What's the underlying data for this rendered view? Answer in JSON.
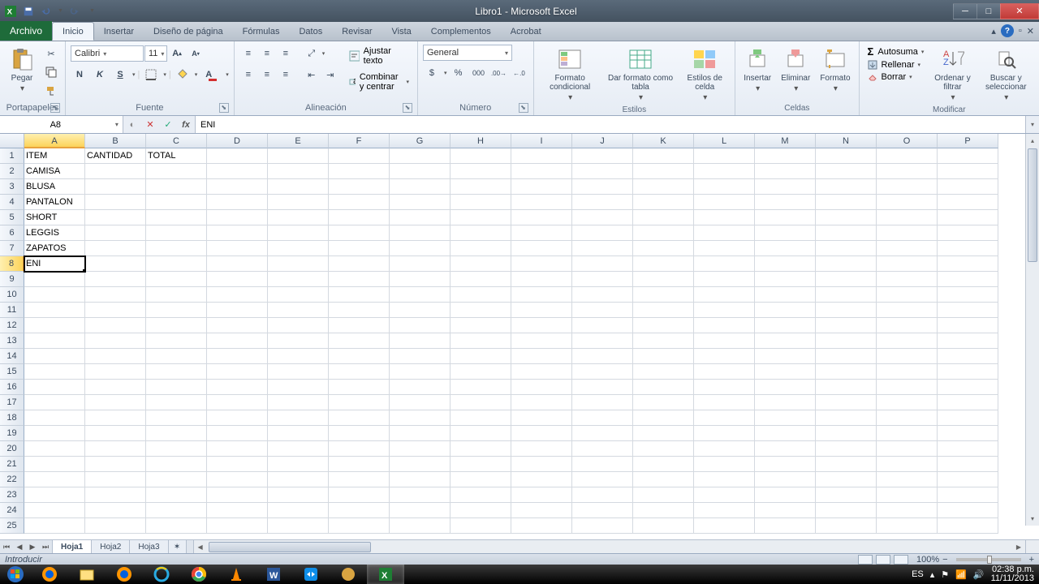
{
  "window": {
    "title": "Libro1 - Microsoft Excel"
  },
  "tabs": {
    "file": "Archivo",
    "items": [
      "Inicio",
      "Insertar",
      "Diseño de página",
      "Fórmulas",
      "Datos",
      "Revisar",
      "Vista",
      "Complementos",
      "Acrobat"
    ],
    "active": 0
  },
  "ribbon": {
    "clipboard": {
      "label": "Portapapeles",
      "paste": "Pegar"
    },
    "font": {
      "label": "Fuente",
      "name": "Calibri",
      "size": "11"
    },
    "alignment": {
      "label": "Alineación",
      "wrap": "Ajustar texto",
      "merge": "Combinar y centrar"
    },
    "number": {
      "label": "Número",
      "format": "General"
    },
    "styles": {
      "label": "Estilos",
      "cond": "Formato condicional",
      "table": "Dar formato como tabla",
      "cell": "Estilos de celda"
    },
    "cells": {
      "label": "Celdas",
      "insert": "Insertar",
      "delete": "Eliminar",
      "format": "Formato"
    },
    "editing": {
      "label": "Modificar",
      "sum": "Autosuma",
      "fill": "Rellenar",
      "clear": "Borrar",
      "sort": "Ordenar y filtrar",
      "find": "Buscar y seleccionar"
    }
  },
  "formula": {
    "cellref": "A8",
    "value": "ENI"
  },
  "columns": [
    "A",
    "B",
    "C",
    "D",
    "E",
    "F",
    "G",
    "H",
    "I",
    "J",
    "K",
    "L",
    "M",
    "N",
    "O",
    "P"
  ],
  "rows": 25,
  "activeCell": {
    "col": 0,
    "row": 7
  },
  "data": {
    "1": {
      "A": "ITEM",
      "B": "CANTIDAD",
      "C": "TOTAL"
    },
    "2": {
      "A": "CAMISA"
    },
    "3": {
      "A": "BLUSA"
    },
    "4": {
      "A": "PANTALON"
    },
    "5": {
      "A": "SHORT"
    },
    "6": {
      "A": "LEGGIS"
    },
    "7": {
      "A": "ZAPATOS"
    },
    "8": {
      "A": "ENI"
    }
  },
  "sheets": {
    "items": [
      "Hoja1",
      "Hoja2",
      "Hoja3"
    ],
    "active": 0
  },
  "status": {
    "mode": "Introducir",
    "zoom": "100%"
  },
  "taskbar": {
    "lang": "ES",
    "time": "02:38 p.m.",
    "date": "11/11/2013"
  }
}
